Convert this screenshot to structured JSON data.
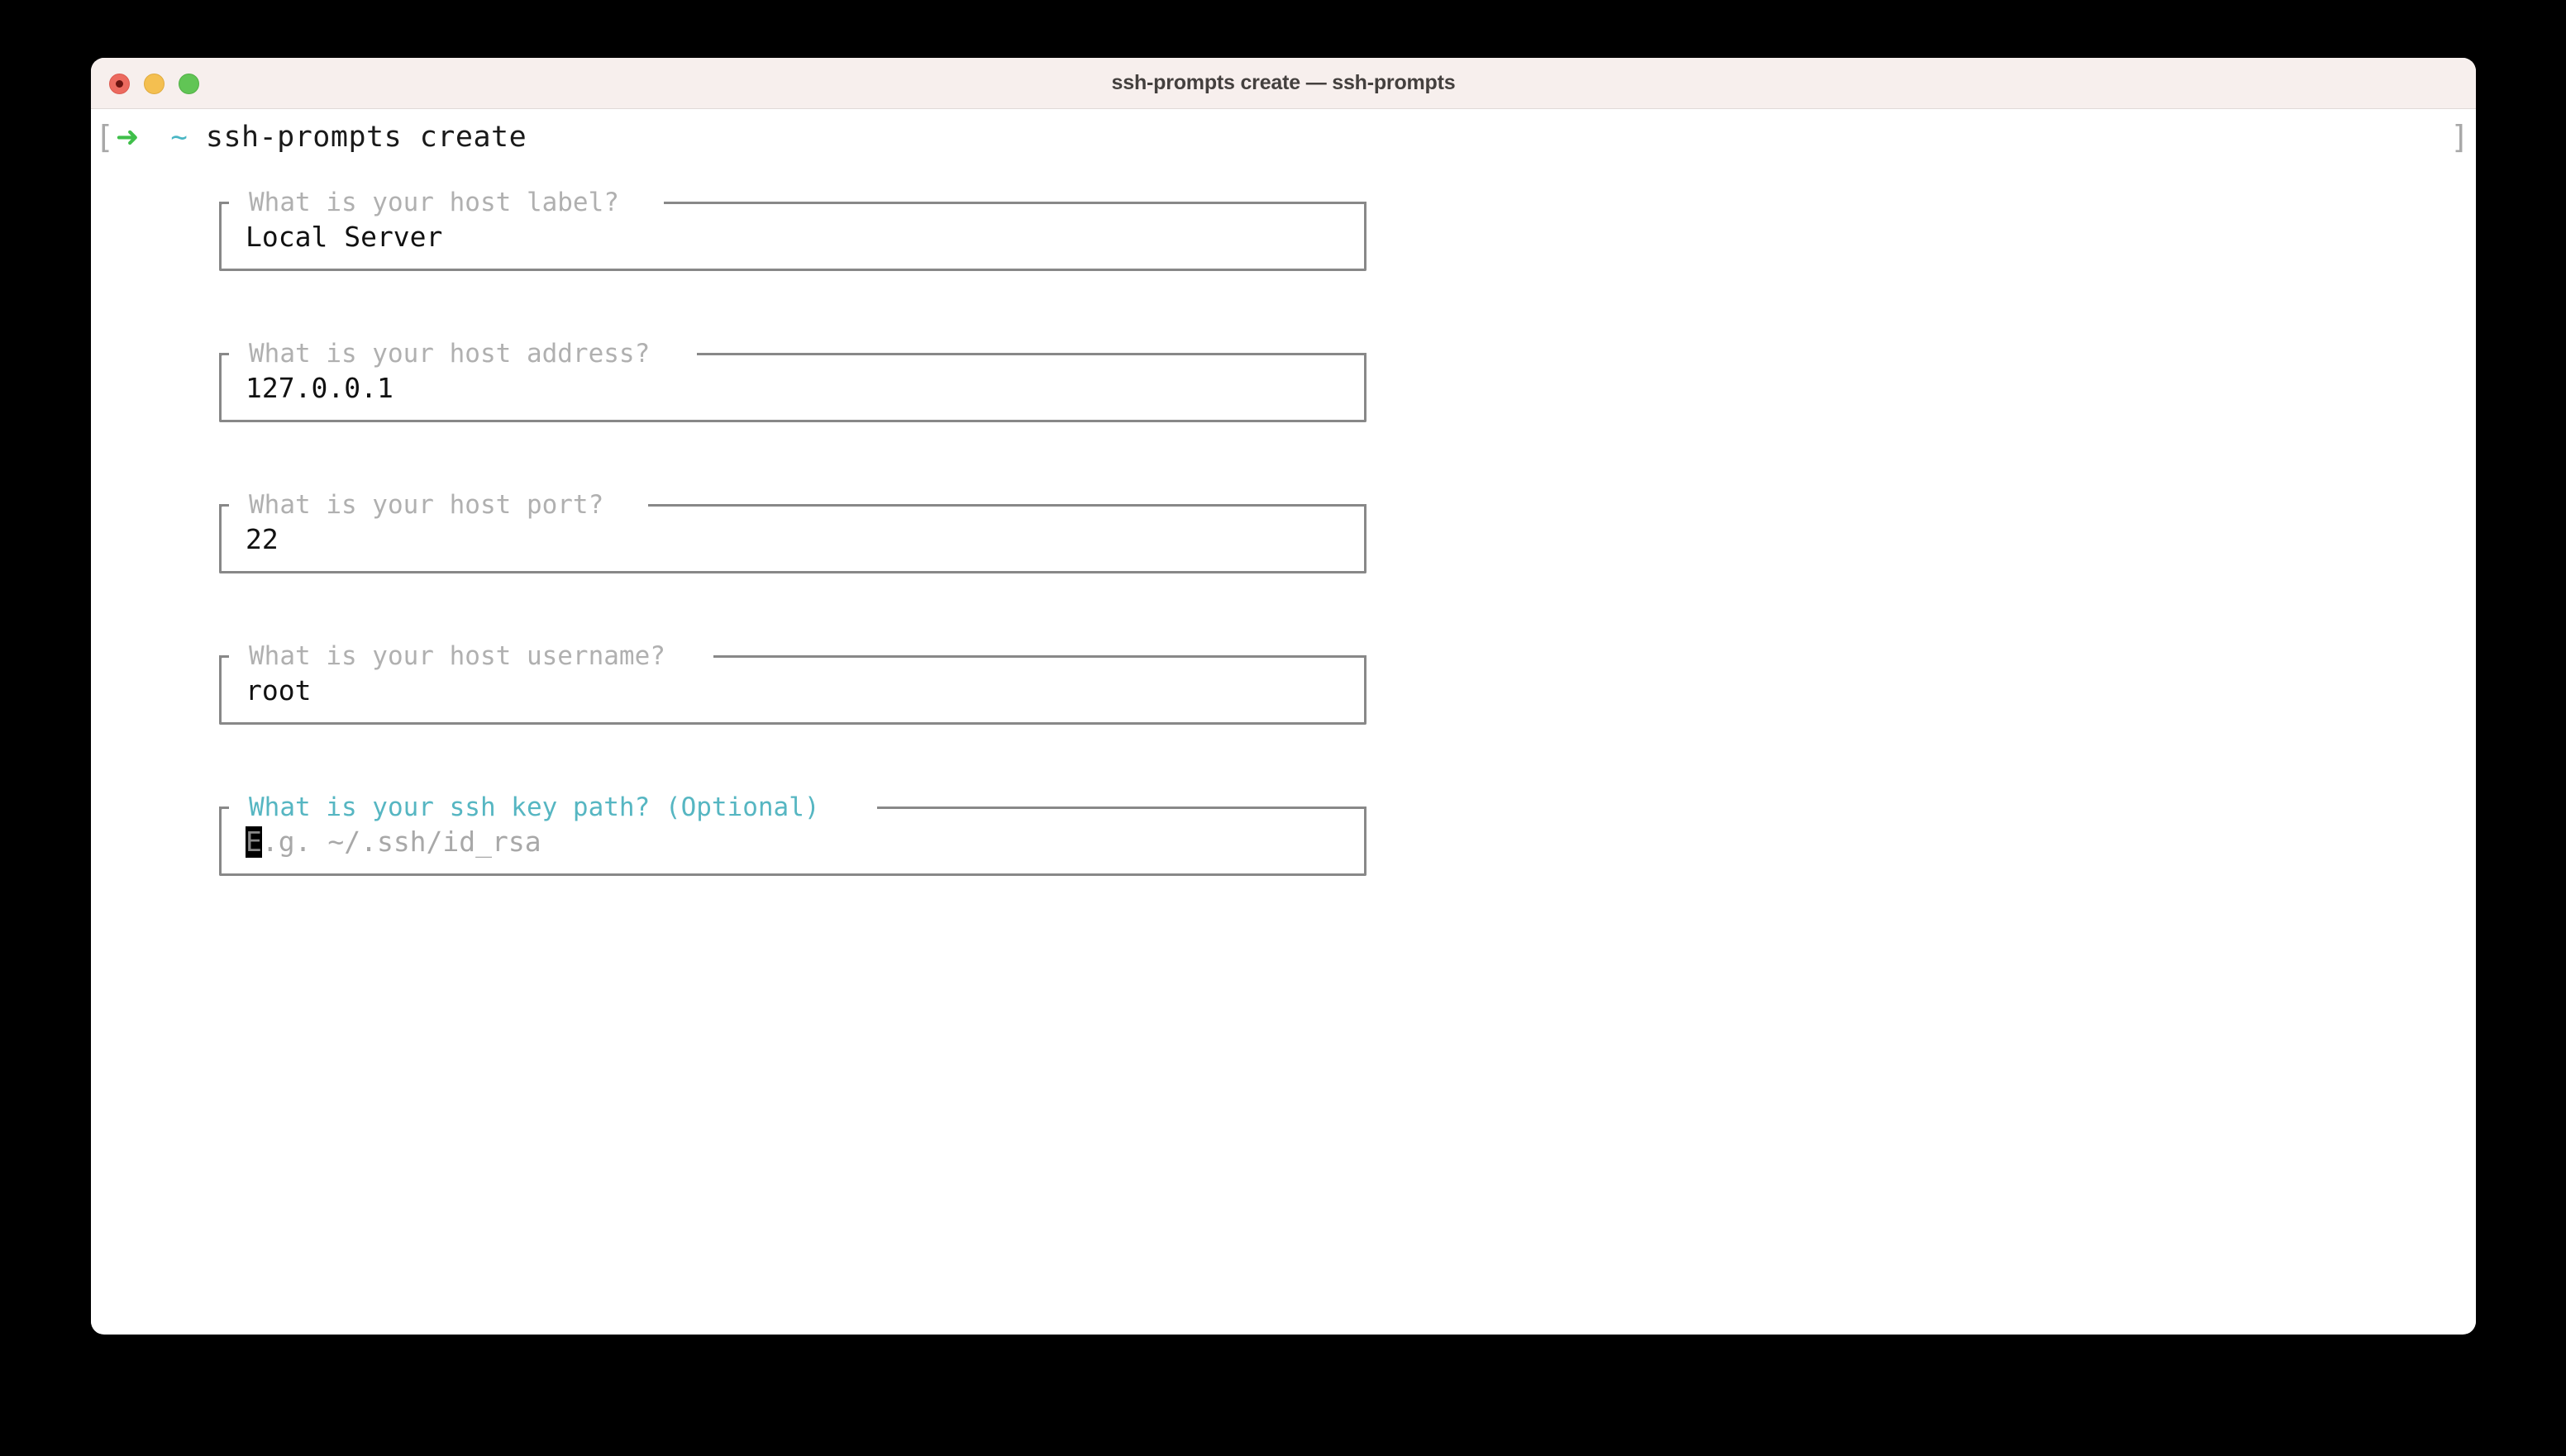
{
  "window": {
    "title": "ssh-prompts create — ssh-prompts",
    "traffic_lights": {
      "close": "close-button",
      "minimize": "minimize-button",
      "maximize": "maximize-button"
    }
  },
  "prompt": {
    "bracket_left": "[",
    "bracket_right": "]",
    "arrow": "➜",
    "path": "~",
    "command": "ssh-prompts create"
  },
  "colors": {
    "accent_teal": "#56b6c2",
    "prompt_green": "#3fbf4a",
    "label_gray": "#b0b0b0",
    "border_gray": "#888888",
    "titlebar_bg": "#f7efed",
    "terminal_bg": "#ffffff"
  },
  "form": {
    "fields": [
      {
        "label": "What is your host label?",
        "value": "Local Server",
        "placeholder": "",
        "active": false,
        "name": "host-label"
      },
      {
        "label": "What is your host address?",
        "value": "127.0.0.1",
        "placeholder": "",
        "active": false,
        "name": "host-address"
      },
      {
        "label": "What is your host port?",
        "value": "22",
        "placeholder": "",
        "active": false,
        "name": "host-port"
      },
      {
        "label": "What is your host username?",
        "value": "root",
        "placeholder": "",
        "active": false,
        "name": "host-username"
      },
      {
        "label": "What is your ssh key path? (Optional)",
        "value": "",
        "placeholder": "E.g. ~/.ssh/id_rsa",
        "cursor_char": "E",
        "placeholder_rest": ".g. ~/.ssh/id_rsa",
        "active": true,
        "name": "ssh-key-path"
      }
    ]
  }
}
